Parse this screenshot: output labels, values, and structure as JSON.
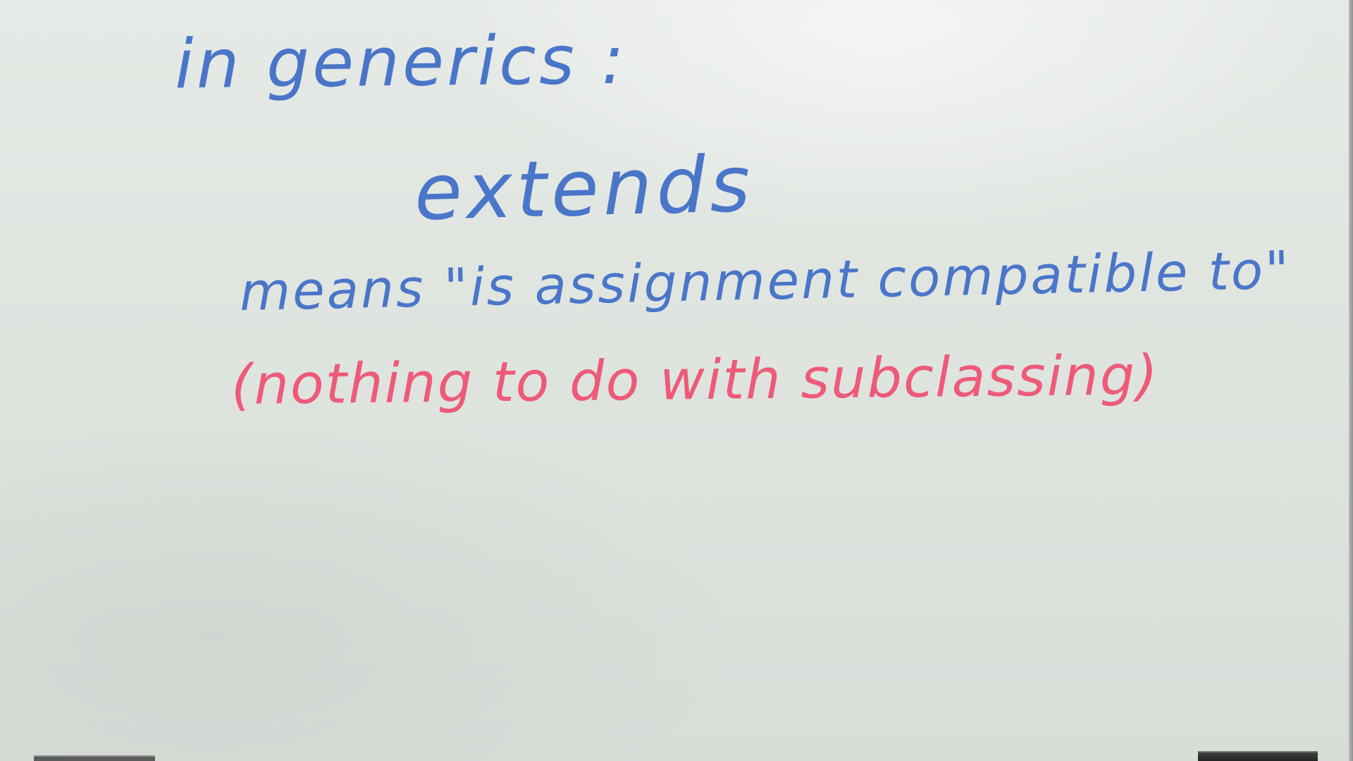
{
  "whiteboard": {
    "line1": "in generics :",
    "line2": "extends",
    "line3": "means \"is assignment compatible to\"",
    "line4": "(nothing to do with subclassing)",
    "ink_colors": {
      "blue": "#4a76c9",
      "red": "#ee5a78"
    }
  }
}
